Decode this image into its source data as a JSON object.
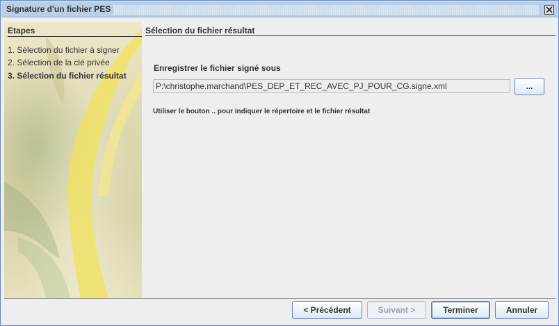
{
  "window": {
    "title": "Signature d'un fichier PES",
    "close_icon": "close-icon"
  },
  "steps": {
    "header": "Etapes",
    "items": [
      {
        "label": "1. Sélection du fichier à signer",
        "current": false
      },
      {
        "label": "2. Sélection de la clé privée",
        "current": false
      },
      {
        "label": "3. Sélection du fichier résultat",
        "current": true
      }
    ]
  },
  "main": {
    "section_title": "Sélection du fichier résultat",
    "field_label": "Enregistrer le fichier signé sous",
    "field_value": "P:\\christophe.marchand\\PES_DEP_ET_REC_AVEC_PJ_POUR_CG.signe.xml",
    "browse_label": "...",
    "hint": "Utiliser le bouton .. pour indiquer le répertoire et le fichier résultat"
  },
  "footer": {
    "previous_label": "< Précédent",
    "next_label": "Suivant >",
    "finish_label": "Terminer",
    "cancel_label": "Annuler",
    "next_enabled": false
  }
}
